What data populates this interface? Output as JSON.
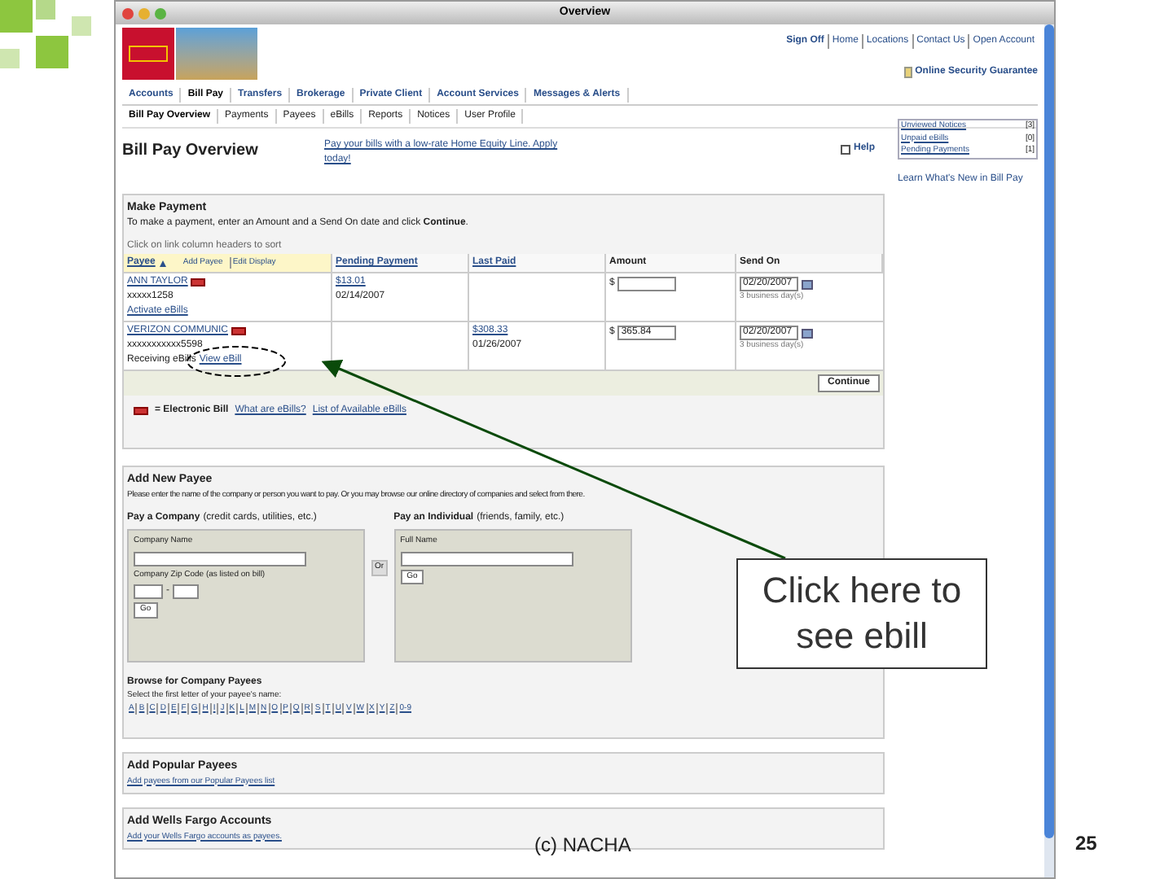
{
  "window": {
    "title": "Overview"
  },
  "header_links": [
    "Sign Off",
    "Home",
    "Locations",
    "Contact Us",
    "Open Account"
  ],
  "security_link": "Online Security Guarantee",
  "main_tabs": [
    {
      "label": "Accounts",
      "selected": false
    },
    {
      "label": "Bill Pay",
      "selected": true
    },
    {
      "label": "Transfers",
      "selected": false
    },
    {
      "label": "Brokerage",
      "selected": false
    },
    {
      "label": "Private Client",
      "selected": false
    },
    {
      "label": "Account Services",
      "selected": false
    },
    {
      "label": "Messages & Alerts",
      "selected": false
    }
  ],
  "sub_tabs": [
    {
      "label": "Bill Pay Overview",
      "selected": true
    },
    {
      "label": "Payments",
      "selected": false
    },
    {
      "label": "Payees",
      "selected": false
    },
    {
      "label": "eBills",
      "selected": false
    },
    {
      "label": "Reports",
      "selected": false
    },
    {
      "label": "Notices",
      "selected": false
    },
    {
      "label": "User Profile",
      "selected": false
    }
  ],
  "page_title": "Bill Pay Overview",
  "promo_link": "Pay your bills with a low-rate Home Equity Line. Apply today!",
  "help": "Help",
  "summary_links": [
    {
      "label": "Unviewed Notices",
      "count": "[3]"
    },
    {
      "label": "Unpaid eBills",
      "count": "[0]"
    },
    {
      "label": "Pending Payments",
      "count": "[1]"
    }
  ],
  "learn_link": "Learn What's New in Bill Pay",
  "make_payment": {
    "title": "Make Payment",
    "instruction": "To make a payment, enter an Amount and a Send On date and click **Continue**.",
    "sort_hint": "Click on link column headers to sort",
    "columns": [
      {
        "label": "Payee",
        "links": [
          "Add Payee",
          "Edit Display"
        ]
      },
      {
        "label": "Pending Payment"
      },
      {
        "label": "Last Paid"
      },
      {
        "label": "Amount"
      },
      {
        "label": "Send On"
      }
    ],
    "rows": [
      {
        "payee": "ANN TAYLOR",
        "account": "xxxxx1258",
        "note": "",
        "link": "Activate eBills",
        "pending": "$13.01",
        "pending_date": "02/14/2007",
        "last_paid": "",
        "last_paid_date": "",
        "amount": "",
        "send_on": "02/20/2007",
        "days": "3 business day(s)"
      },
      {
        "payee": "VERIZON COMMUNIC",
        "account": "xxxxxxxxxxx5598",
        "note": "Receiving eBills",
        "link": "View eBill",
        "pending": "",
        "pending_date": "",
        "last_paid": "$308.33",
        "last_paid_date": "01/26/2007",
        "amount": "365.84",
        "send_on": "02/20/2007",
        "days": "3 business day(s)"
      }
    ],
    "currency": "$",
    "continue_button": "Continue",
    "legend": "= Electronic Bill",
    "legend_links": [
      "What are eBills?",
      "List of Available eBills"
    ]
  },
  "add_payee": {
    "title": "Add New Payee",
    "description": "Please enter the name of the company or person you want to pay. Or you may browse our online directory of companies and select from there.",
    "company": {
      "heading": "Pay a Company",
      "hint": "(credit cards, utilities, etc.)",
      "name_label": "Company Name",
      "zip_label": "Company Zip Code (as listed on bill)",
      "zip_separator": "-",
      "button": "Go"
    },
    "or": "Or",
    "individual": {
      "heading": "Pay an Individual",
      "hint": "(friends, family, etc.)",
      "name_label": "Full Name",
      "button": "Go"
    },
    "browse_title": "Browse for Company Payees",
    "browse_hint": "Select the first letter of your payee's name:",
    "letters": [
      "A",
      "B",
      "C",
      "D",
      "E",
      "F",
      "G",
      "H",
      "I",
      "J",
      "K",
      "L",
      "M",
      "N",
      "O",
      "P",
      "Q",
      "R",
      "S",
      "T",
      "U",
      "V",
      "W",
      "X",
      "Y",
      "Z",
      "0-9"
    ]
  },
  "popular": {
    "title": "Add Popular Payees",
    "link": "Add payees from our Popular Payees list"
  },
  "wf_accounts": {
    "title": "Add Wells Fargo Accounts",
    "link": "Add your Wells Fargo accounts as payees."
  },
  "callout": "Click here to see ebill",
  "footer": "(c) NACHA",
  "slide_number": "25"
}
